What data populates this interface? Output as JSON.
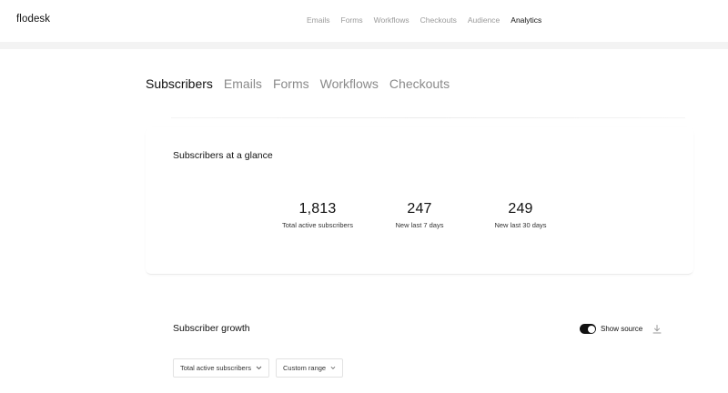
{
  "app": {
    "logo": "flodesk"
  },
  "topnav": {
    "items": [
      {
        "label": "Emails",
        "active": false
      },
      {
        "label": "Forms",
        "active": false
      },
      {
        "label": "Workflows",
        "active": false
      },
      {
        "label": "Checkouts",
        "active": false
      },
      {
        "label": "Audience",
        "active": false
      },
      {
        "label": "Analytics",
        "active": true
      }
    ]
  },
  "subtabs": {
    "items": [
      {
        "label": "Subscribers",
        "active": true
      },
      {
        "label": "Emails",
        "active": false
      },
      {
        "label": "Forms",
        "active": false
      },
      {
        "label": "Workflows",
        "active": false
      },
      {
        "label": "Checkouts",
        "active": false
      }
    ]
  },
  "glance": {
    "title": "Subscribers at a glance",
    "stats": [
      {
        "value": "1,813",
        "label": "Total active subscribers"
      },
      {
        "value": "247",
        "label": "New last 7 days"
      },
      {
        "value": "249",
        "label": "New last 30 days"
      }
    ]
  },
  "growth": {
    "title": "Subscriber growth",
    "show_source_label": "Show source",
    "show_source_on": true,
    "metric_select": "Total active subscribers",
    "range_select": "Custom range"
  },
  "icons": {
    "download": "download-icon",
    "chevron": "chevron-down-icon"
  }
}
